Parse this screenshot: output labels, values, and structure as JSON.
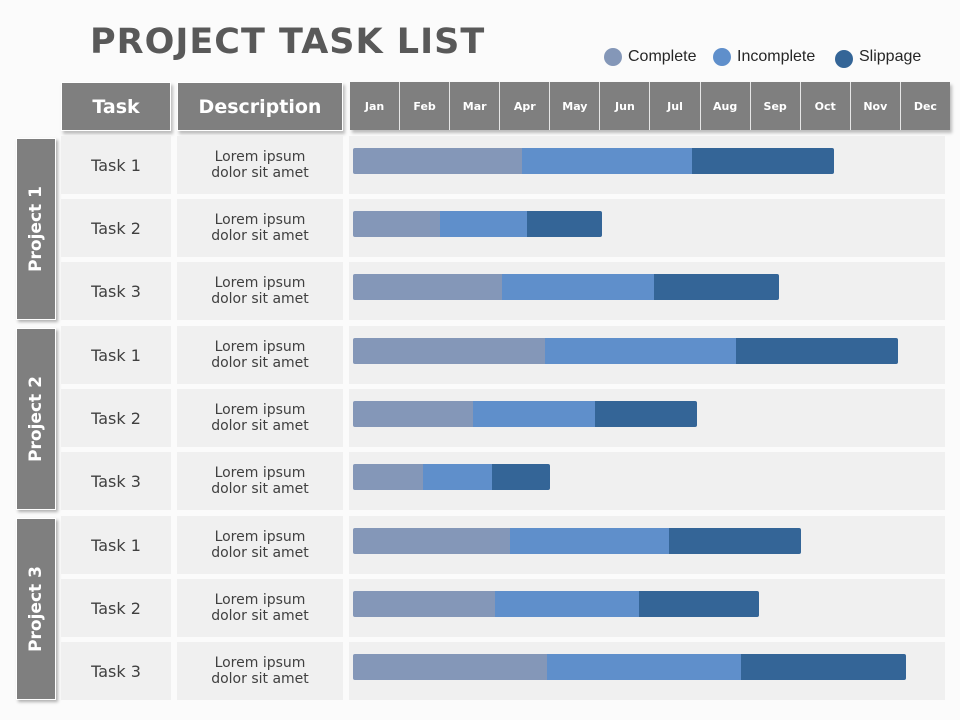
{
  "title": "PROJECT TASK LIST",
  "legend": [
    {
      "label": "Complete",
      "color": "#8497b8"
    },
    {
      "label": "Incomplete",
      "color": "#5f8fcb"
    },
    {
      "label": "Slippage",
      "color": "#346597"
    }
  ],
  "headers": {
    "task": "Task",
    "description": "Description"
  },
  "chart_data": {
    "type": "bar",
    "subtype": "stacked-horizontal-gantt",
    "title": "PROJECT TASK LIST",
    "x_categories": [
      "Jan",
      "Feb",
      "Mar",
      "Apr",
      "May",
      "Jun",
      "Jul",
      "Aug",
      "Sep",
      "Oct",
      "Nov",
      "Dec"
    ],
    "x_unit": "months from start of Jan",
    "xlim": [
      0,
      12
    ],
    "series_names": [
      "Complete",
      "Incomplete",
      "Slippage"
    ],
    "groups": [
      {
        "project": "Project 1",
        "tasks": [
          {
            "task": "Task 1",
            "description": "Lorem ipsum dolor sit amet",
            "complete_end": 3.4,
            "incomplete_end": 6.8,
            "slippage_end": 9.65
          },
          {
            "task": "Task 2",
            "description": "Lorem ipsum dolor sit amet",
            "complete_end": 1.75,
            "incomplete_end": 3.5,
            "slippage_end": 5.0
          },
          {
            "task": "Task 3",
            "description": "Lorem ipsum dolor sit amet",
            "complete_end": 3.0,
            "incomplete_end": 6.05,
            "slippage_end": 8.55
          }
        ]
      },
      {
        "project": "Project 2",
        "tasks": [
          {
            "task": "Task 1",
            "description": "Lorem ipsum dolor sit amet",
            "complete_end": 3.85,
            "incomplete_end": 7.7,
            "slippage_end": 10.95
          },
          {
            "task": "Task 2",
            "description": "Lorem ipsum dolor sit amet",
            "complete_end": 2.4,
            "incomplete_end": 4.85,
            "slippage_end": 6.9
          },
          {
            "task": "Task 3",
            "description": "Lorem ipsum dolor sit amet",
            "complete_end": 1.4,
            "incomplete_end": 2.8,
            "slippage_end": 3.95
          }
        ]
      },
      {
        "project": "Project 3",
        "tasks": [
          {
            "task": "Task 1",
            "description": "Lorem ipsum dolor sit amet",
            "complete_end": 3.15,
            "incomplete_end": 6.35,
            "slippage_end": 9.0
          },
          {
            "task": "Task 2",
            "description": "Lorem ipsum dolor sit amet",
            "complete_end": 2.85,
            "incomplete_end": 5.75,
            "slippage_end": 8.15
          },
          {
            "task": "Task 3",
            "description": "Lorem ipsum dolor sit amet",
            "complete_end": 3.9,
            "incomplete_end": 7.8,
            "slippage_end": 11.1
          }
        ]
      }
    ]
  }
}
